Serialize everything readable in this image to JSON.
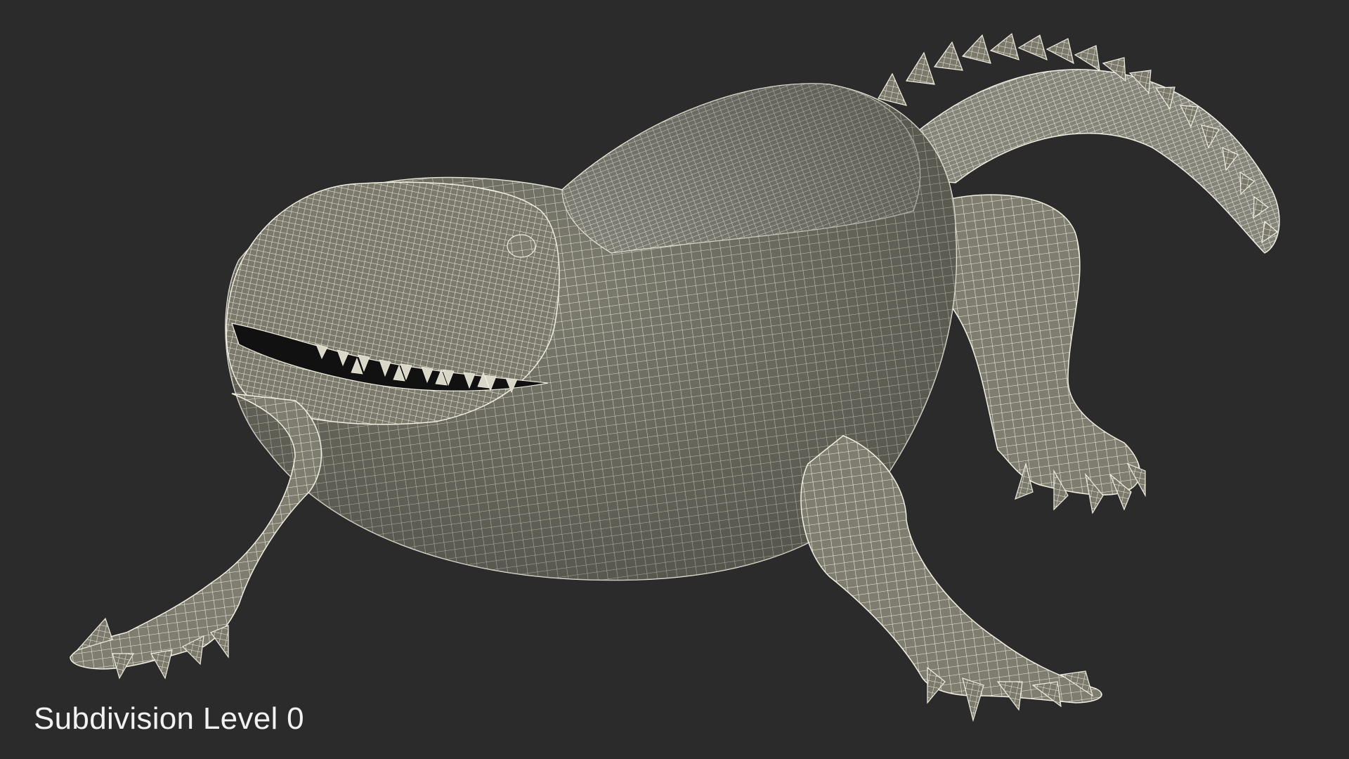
{
  "viewport": {
    "background_color": "#2b2b2b",
    "model": {
      "subject": "crocodile-wireframe",
      "surface_color": "#7e7d70",
      "wire_color": "#f2f0e2"
    }
  },
  "caption": {
    "text": "Subdivision Level 0",
    "color": "#f2f2f2"
  }
}
